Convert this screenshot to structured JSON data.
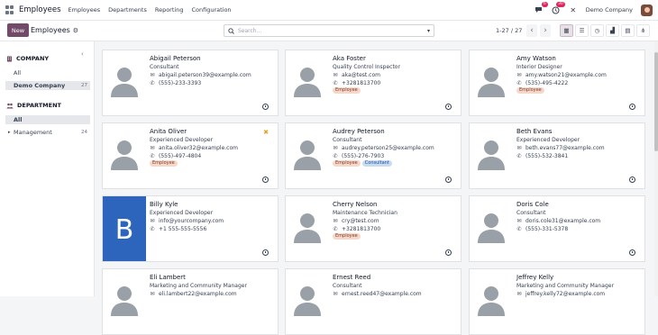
{
  "navbar": {
    "app_name": "Employees",
    "menu": [
      "Employees",
      "Departments",
      "Reporting",
      "Configuration"
    ],
    "chat_badge": "6",
    "activity_badge": "30",
    "company": "Demo Company"
  },
  "control": {
    "new_label": "New",
    "breadcrumb": "Employees",
    "search_placeholder": "Search...",
    "pager": "1-27 / 27"
  },
  "sidebar": {
    "company_title": "COMPANY",
    "company_items": [
      {
        "label": "All",
        "count": ""
      },
      {
        "label": "Demo Company",
        "count": "27"
      }
    ],
    "department_title": "DEPARTMENT",
    "department_items": [
      {
        "label": "All",
        "count": ""
      },
      {
        "label": "Management",
        "count": "24"
      }
    ]
  },
  "employees": [
    {
      "name": "Abigail Peterson",
      "job": "Consultant",
      "email": "abigail.peterson39@example.com",
      "phone": "(555)-233-3393",
      "tags": []
    },
    {
      "name": "Aka Foster",
      "job": "Quality Control Inspector",
      "email": "aka@test.com",
      "phone": "+3281813700",
      "tags": [
        "Employee"
      ]
    },
    {
      "name": "Amy Watson",
      "job": "Interior Designer",
      "email": "amy.watson21@example.com",
      "phone": "(535)-495-4222",
      "tags": [
        "Employee"
      ]
    },
    {
      "name": "Anita Oliver",
      "job": "Experienced Developer",
      "email": "anita.oliver32@example.com",
      "phone": "(555)-497-4804",
      "tags": [
        "Employee"
      ]
    },
    {
      "name": "Audrey Peterson",
      "job": "Consultant",
      "email": "audrey.peterson25@example.com",
      "phone": "(555)-276-7903",
      "tags": [
        "Employee",
        "Consultant"
      ]
    },
    {
      "name": "Beth Evans",
      "job": "Experienced Developer",
      "email": "beth.evans77@example.com",
      "phone": "(555)-532-3841",
      "tags": []
    },
    {
      "name": "Billy Kyle",
      "job": "Experienced Developer",
      "email": "info@yourcompany.com",
      "phone": "+1 555-555-5556",
      "tags": [],
      "initial": "B"
    },
    {
      "name": "Cherry Nelson",
      "job": "Maintenance Technician",
      "email": "cry@test.com",
      "phone": "+3281813700",
      "tags": [
        "Employee"
      ]
    },
    {
      "name": "Doris Cole",
      "job": "Consultant",
      "email": "doris.cole31@example.com",
      "phone": "(555)-331-5378",
      "tags": []
    },
    {
      "name": "Eli Lambert",
      "job": "Marketing and Community Manager",
      "email": "eli.lambert22@example.com",
      "phone": "",
      "tags": []
    },
    {
      "name": "Ernest Reed",
      "job": "Consultant",
      "email": "ernest.reed47@example.com",
      "phone": "",
      "tags": []
    },
    {
      "name": "Jeffrey Kelly",
      "job": "Marketing and Community Manager",
      "email": "jeffrey.kelly72@example.com",
      "phone": "",
      "tags": []
    }
  ]
}
